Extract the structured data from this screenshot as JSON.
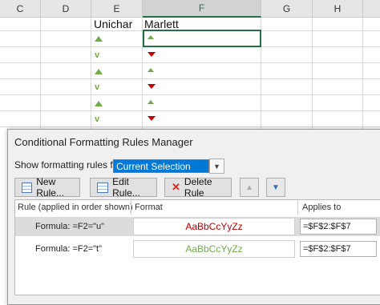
{
  "sheet": {
    "columns": [
      "C",
      "D",
      "E",
      "F",
      "G",
      "H"
    ],
    "selected_column": "F",
    "header_e": "Unichar",
    "header_f": "Marlett",
    "colors": {
      "up": "#70ad47",
      "down": "#c00000",
      "selection": "#217346"
    }
  },
  "dialog": {
    "title": "Conditional Formatting Rules Manager",
    "show_label": "Show formatting rules for:",
    "show_value": "Current Selection",
    "new_rule": "New Rule...",
    "edit_rule": "Edit Rule...",
    "delete_rule": "Delete Rule",
    "headers": {
      "rule": "Rule (applied in order shown)",
      "format": "Format",
      "applies": "Applies to"
    },
    "rules": [
      {
        "formula": "Formula: =F2=\"u\"",
        "preview": "AaBbCcYyZz",
        "preview_color": "#c00000",
        "applies": "=$F$2:$F$7"
      },
      {
        "formula": "Formula: =F2=\"t\"",
        "preview": "AaBbCcYyZz",
        "preview_color": "#70ad47",
        "applies": "=$F$2:$F$7"
      }
    ]
  }
}
